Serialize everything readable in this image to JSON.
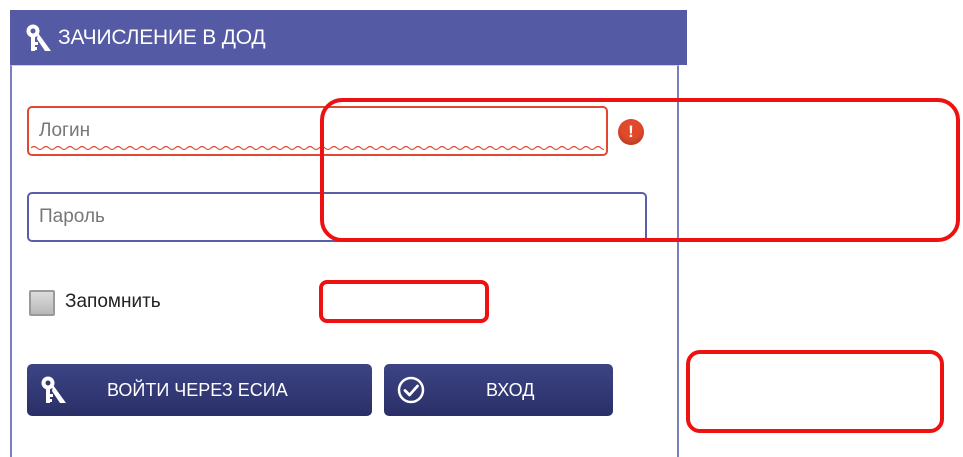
{
  "header": {
    "title": "ЗАЧИСЛЕНИЕ В ДОД",
    "icon": "esia-key-icon",
    "background": "#545aa3"
  },
  "form": {
    "login": {
      "placeholder": "Логин",
      "value": "",
      "state": "error",
      "border_color": "#e0492e"
    },
    "password": {
      "placeholder": "Пароль",
      "value": ""
    },
    "error_icon": "alert-icon",
    "remember": {
      "label": "Запомнить",
      "checked": false
    }
  },
  "buttons": {
    "esia": {
      "label": "ВОЙТИ ЧЕРЕЗ ЕСИА",
      "icon": "esia-key-icon"
    },
    "login": {
      "label": "ВХОД",
      "icon": "check-circle-icon"
    },
    "background": "#2f3570"
  },
  "annotations": {
    "color": "#ee1111",
    "count": 3
  }
}
